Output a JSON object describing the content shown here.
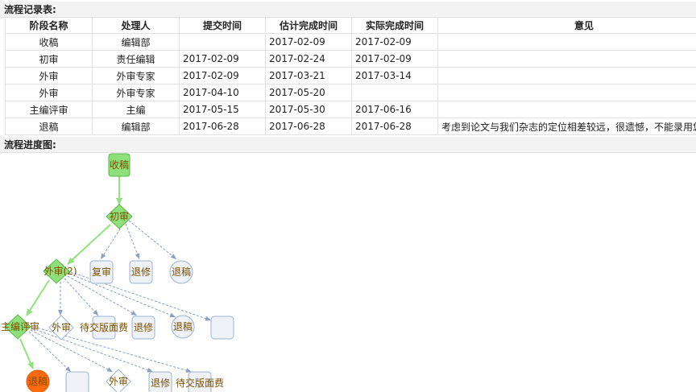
{
  "record_section_title": "流程记录表:",
  "progress_section_title": "流程进度图:",
  "table": {
    "headers": [
      "阶段名称",
      "处理人",
      "提交时间",
      "估计完成时间",
      "实际完成时间",
      "意见"
    ],
    "rows": [
      [
        "收稿",
        "编辑部",
        "",
        "2017-02-09",
        "2017-02-09",
        ""
      ],
      [
        "初审",
        "责任编辑",
        "2017-02-09",
        "2017-02-24",
        "2017-02-09",
        ""
      ],
      [
        "外审",
        "外审专家",
        "2017-02-09",
        "2017-03-21",
        "2017-03-14",
        ""
      ],
      [
        "外审",
        "外审专家",
        "2017-04-10",
        "2017-05-20",
        "",
        ""
      ],
      [
        "主编评审",
        "主编",
        "2017-05-15",
        "2017-05-30",
        "2017-06-16",
        ""
      ],
      [
        "退稿",
        "编辑部",
        "2017-06-28",
        "2017-06-28",
        "2017-06-28",
        "考虑到论文与我们杂志的定位相差较远，很遗憾，不能录用您的稿件"
      ]
    ]
  },
  "flow": {
    "nodes": {
      "receive": "收稿",
      "first_review": "初审",
      "external_review": "外审(2)",
      "re_review_1": "复审",
      "revise_1": "退修",
      "reject_1": "退稿",
      "chief_review": "主编评审",
      "external_2": "外审",
      "pending_fee_1": "待交版面费",
      "revise_2": "退修",
      "reject_2": "退稿",
      "blank_1": "",
      "reject_final": "退稿",
      "blank_2": "",
      "external_3": "外审",
      "revise_3": "退修",
      "pending_fee_2": "待交版面费"
    },
    "colors": {
      "passed_fill": "#8ee07a",
      "passed_stroke": "#5cb84a",
      "passed_edge": "#8fe27c",
      "pending_fill": "#eef1f6",
      "pending_stroke": "#9fb3d1",
      "pending_edge": "#8aa0c6",
      "current_fill": "#ff6a10",
      "label_text": "#7a5000"
    }
  }
}
